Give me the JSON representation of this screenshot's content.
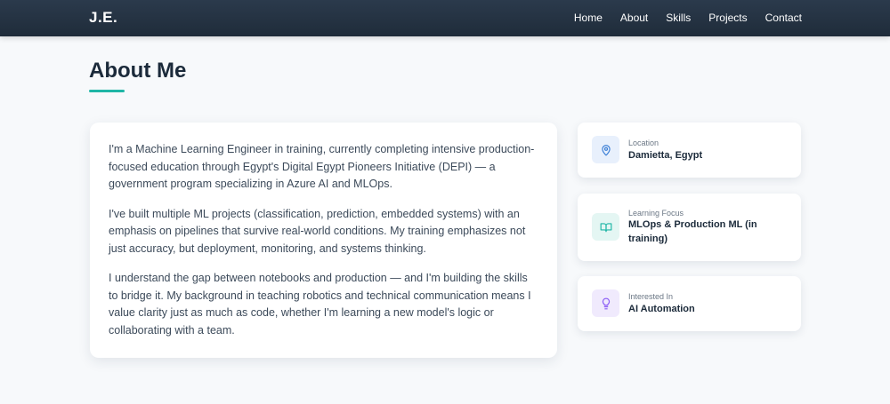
{
  "nav": {
    "brand": "J.E.",
    "links": [
      "Home",
      "About",
      "Skills",
      "Projects",
      "Contact"
    ]
  },
  "section": {
    "title": "About Me"
  },
  "about": {
    "paragraphs": [
      "I'm a Machine Learning Engineer in training, currently completing intensive production-focused education through Egypt's Digital Egypt Pioneers Initiative (DEPI) — a government program specializing in Azure AI and MLOps.",
      "I've built multiple ML projects (classification, prediction, embedded systems) with an emphasis on pipelines that survive real-world conditions. My training emphasizes not just accuracy, but deployment, monitoring, and systems thinking.",
      "I understand the gap between notebooks and production — and I'm building the skills to bridge it. My background in teaching robotics and technical communication means I value clarity just as much as code, whether I'm learning a new model's logic or collaborating with a team."
    ]
  },
  "info_cards": [
    {
      "icon": "location-pin-icon",
      "label": "Location",
      "value": "Damietta, Egypt",
      "accent": "#3b7fd6",
      "bg": "#e8f0fc"
    },
    {
      "icon": "book-icon",
      "label": "Learning Focus",
      "value": "MLOps & Production ML (in training)",
      "accent": "#1fb6a6",
      "bg": "#e4f6f3"
    },
    {
      "icon": "lightbulb-icon",
      "label": "Interested In",
      "value": "AI Automation",
      "accent": "#8b5cf6",
      "bg": "#f0eafd"
    }
  ],
  "colors": {
    "nav_bg": "#243344",
    "accent_teal": "#1fb6a6",
    "page_bg": "#f7f9fb"
  }
}
